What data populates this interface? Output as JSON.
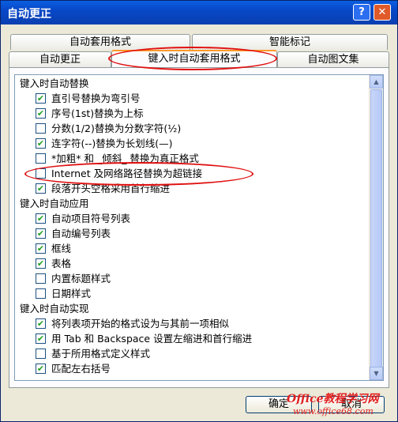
{
  "window": {
    "title": "自动更正"
  },
  "titlebar_buttons": {
    "help": "?",
    "close": "✕"
  },
  "tabs": {
    "row1": [
      "自动套用格式",
      "智能标记"
    ],
    "row2": [
      "自动更正",
      "键入时自动套用格式",
      "自动图文集"
    ],
    "active": "键入时自动套用格式"
  },
  "sections": [
    {
      "title": "键入时自动替换",
      "items": [
        {
          "label": "直引号替换为弯引号",
          "checked": true
        },
        {
          "label": "序号(1st)替换为上标",
          "checked": true
        },
        {
          "label": "分数(1/2)替换为分数字符(½)",
          "checked": false
        },
        {
          "label": "连字符(--)替换为长划线(—)",
          "checked": true
        },
        {
          "label": "*加粗* 和 _倾斜_ 替换为真正格式",
          "checked": false
        },
        {
          "label": "Internet 及网络路径替换为超链接",
          "checked": false
        },
        {
          "label": "段落开头空格采用首行缩进",
          "checked": true
        }
      ]
    },
    {
      "title": "键入时自动应用",
      "items": [
        {
          "label": "自动项目符号列表",
          "checked": true
        },
        {
          "label": "自动编号列表",
          "checked": true
        },
        {
          "label": "框线",
          "checked": true
        },
        {
          "label": "表格",
          "checked": true
        },
        {
          "label": "内置标题样式",
          "checked": false
        },
        {
          "label": "日期样式",
          "checked": false
        }
      ]
    },
    {
      "title": "键入时自动实现",
      "items": [
        {
          "label": "将列表项开始的格式设为与其前一项相似",
          "checked": true
        },
        {
          "label": "用 Tab 和 Backspace 设置左缩进和首行缩进",
          "checked": true
        },
        {
          "label": "基于所用格式定义样式",
          "checked": false
        },
        {
          "label": "匹配左右括号",
          "checked": true
        }
      ]
    }
  ],
  "buttons": {
    "ok": "确定",
    "cancel": "取消"
  },
  "check_glyph": "✔",
  "watermark": {
    "line1": "Office教程学习网",
    "line2": "www.office68.com"
  },
  "colors": {
    "accent": "#0a5ee0",
    "highlight": "#e01010",
    "check": "#21a121"
  }
}
